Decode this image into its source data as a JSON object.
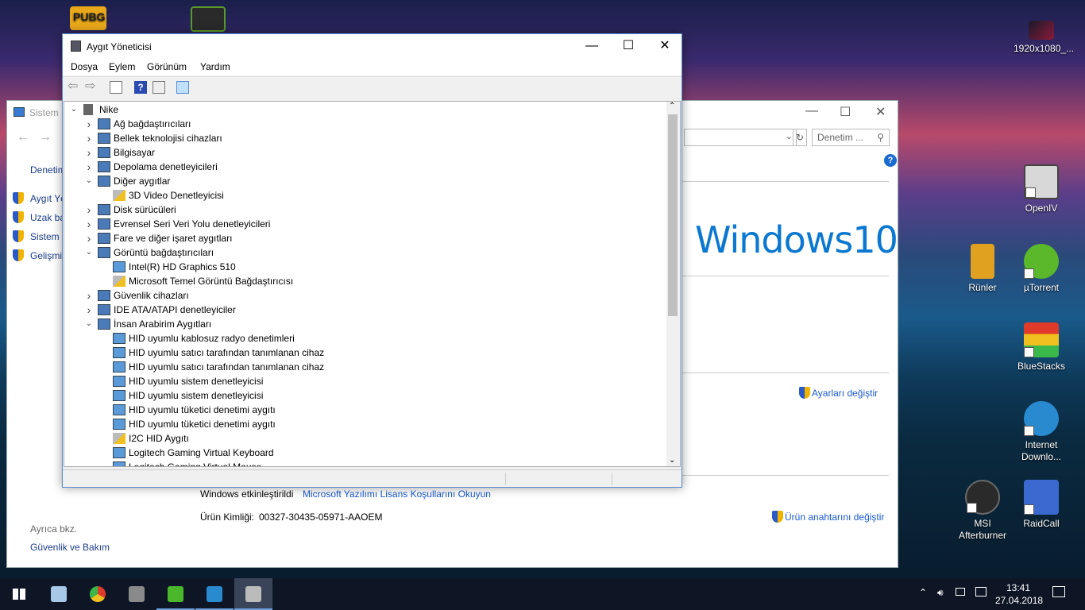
{
  "desktop": {
    "icons": [
      {
        "label": "1920x1080_...",
        "color": "#8a1a3a"
      },
      {
        "label": "OpenIV",
        "color": "#d0d0d0"
      },
      {
        "label": "Rünler",
        "color": "#e0a020"
      },
      {
        "label": "µTorrent",
        "color": "#5ab82a"
      },
      {
        "label": "BlueStacks",
        "color": "#3ab84a"
      },
      {
        "label": "Internet Downlo...",
        "color": "#2a8ad0"
      },
      {
        "label": "MSI Afterburner",
        "color": "#2a2a2a"
      },
      {
        "label": "RaidCall",
        "color": "#3a6ad0"
      },
      {
        "label": "PUBG",
        "color": "#e8a81a"
      },
      {
        "label": "",
        "color": "#5a9a2a"
      }
    ]
  },
  "sistem": {
    "title": "Sistem",
    "nav_back": "←",
    "nav_forward": "→",
    "search_placeholder": "Denetim ...",
    "side_home": "Denetim",
    "side_links": [
      "Aygıt Yö",
      "Uzak ba",
      "Sistem k",
      "Gelişmiş"
    ],
    "windows_logo": "Windows10",
    "change_settings": "Ayarları değiştir",
    "activation_label": "Windows etkinleştirildi",
    "license_link": "Microsoft Yazılımı Lisans Koşullarını Okuyun",
    "product_id_label": "Ürün Kimliği:",
    "product_id": "00327-30435-05971-AAOEM",
    "change_key": "Ürün anahtarını değiştir",
    "see_also": "Ayrıca bkz.",
    "security": "Güvenlik ve Bakım",
    "help": "?"
  },
  "device_manager": {
    "title": "Aygıt Yöneticisi",
    "menu": [
      "Dosya",
      "Eylem",
      "Görünüm",
      "Yardım"
    ],
    "root": "Nike",
    "tree": [
      {
        "label": "Ağ bağdaştırıcıları",
        "level": 1,
        "state": "collapsed"
      },
      {
        "label": "Bellek teknolojisi cihazları",
        "level": 1,
        "state": "collapsed"
      },
      {
        "label": "Bilgisayar",
        "level": 1,
        "state": "collapsed"
      },
      {
        "label": "Depolama denetleyicileri",
        "level": 1,
        "state": "collapsed"
      },
      {
        "label": "Diğer aygıtlar",
        "level": 1,
        "state": "expanded"
      },
      {
        "label": "3D Video Denetleyicisi",
        "level": 2,
        "state": "warning"
      },
      {
        "label": "Disk sürücüleri",
        "level": 1,
        "state": "collapsed"
      },
      {
        "label": "Evrensel Seri Veri Yolu denetleyicileri",
        "level": 1,
        "state": "collapsed"
      },
      {
        "label": "Fare ve diğer işaret aygıtları",
        "level": 1,
        "state": "collapsed"
      },
      {
        "label": "Görüntü bağdaştırıcıları",
        "level": 1,
        "state": "expanded"
      },
      {
        "label": "Intel(R) HD Graphics 510",
        "level": 2,
        "state": "leaf"
      },
      {
        "label": "Microsoft Temel Görüntü Bağdaştırıcısı",
        "level": 2,
        "state": "warning"
      },
      {
        "label": "Güvenlik cihazları",
        "level": 1,
        "state": "collapsed"
      },
      {
        "label": "IDE ATA/ATAPI denetleyiciler",
        "level": 1,
        "state": "collapsed"
      },
      {
        "label": "İnsan Arabirim Aygıtları",
        "level": 1,
        "state": "expanded"
      },
      {
        "label": "HID uyumlu kablosuz radyo denetimleri",
        "level": 2,
        "state": "leaf"
      },
      {
        "label": "HID uyumlu satıcı tarafından tanımlanan cihaz",
        "level": 2,
        "state": "leaf"
      },
      {
        "label": "HID uyumlu satıcı tarafından tanımlanan cihaz",
        "level": 2,
        "state": "leaf"
      },
      {
        "label": "HID uyumlu sistem denetleyicisi",
        "level": 2,
        "state": "leaf"
      },
      {
        "label": "HID uyumlu sistem denetleyicisi",
        "level": 2,
        "state": "leaf"
      },
      {
        "label": "HID uyumlu tüketici denetimi aygıtı",
        "level": 2,
        "state": "leaf"
      },
      {
        "label": "HID uyumlu tüketici denetimi aygıtı",
        "level": 2,
        "state": "leaf"
      },
      {
        "label": "I2C HID Aygıtı",
        "level": 2,
        "state": "warning"
      },
      {
        "label": "Logitech Gaming Virtual Keyboard",
        "level": 2,
        "state": "leaf"
      },
      {
        "label": "Logitech Gaming Virtual Mouse",
        "level": 2,
        "state": "leaf"
      }
    ]
  },
  "taskbar": {
    "time": "13:41",
    "date": "27.04.2018",
    "apps": [
      "start",
      "task-manager",
      "chrome",
      "device-manager-app",
      "razer",
      "control-panel",
      "device-manager-active"
    ]
  }
}
